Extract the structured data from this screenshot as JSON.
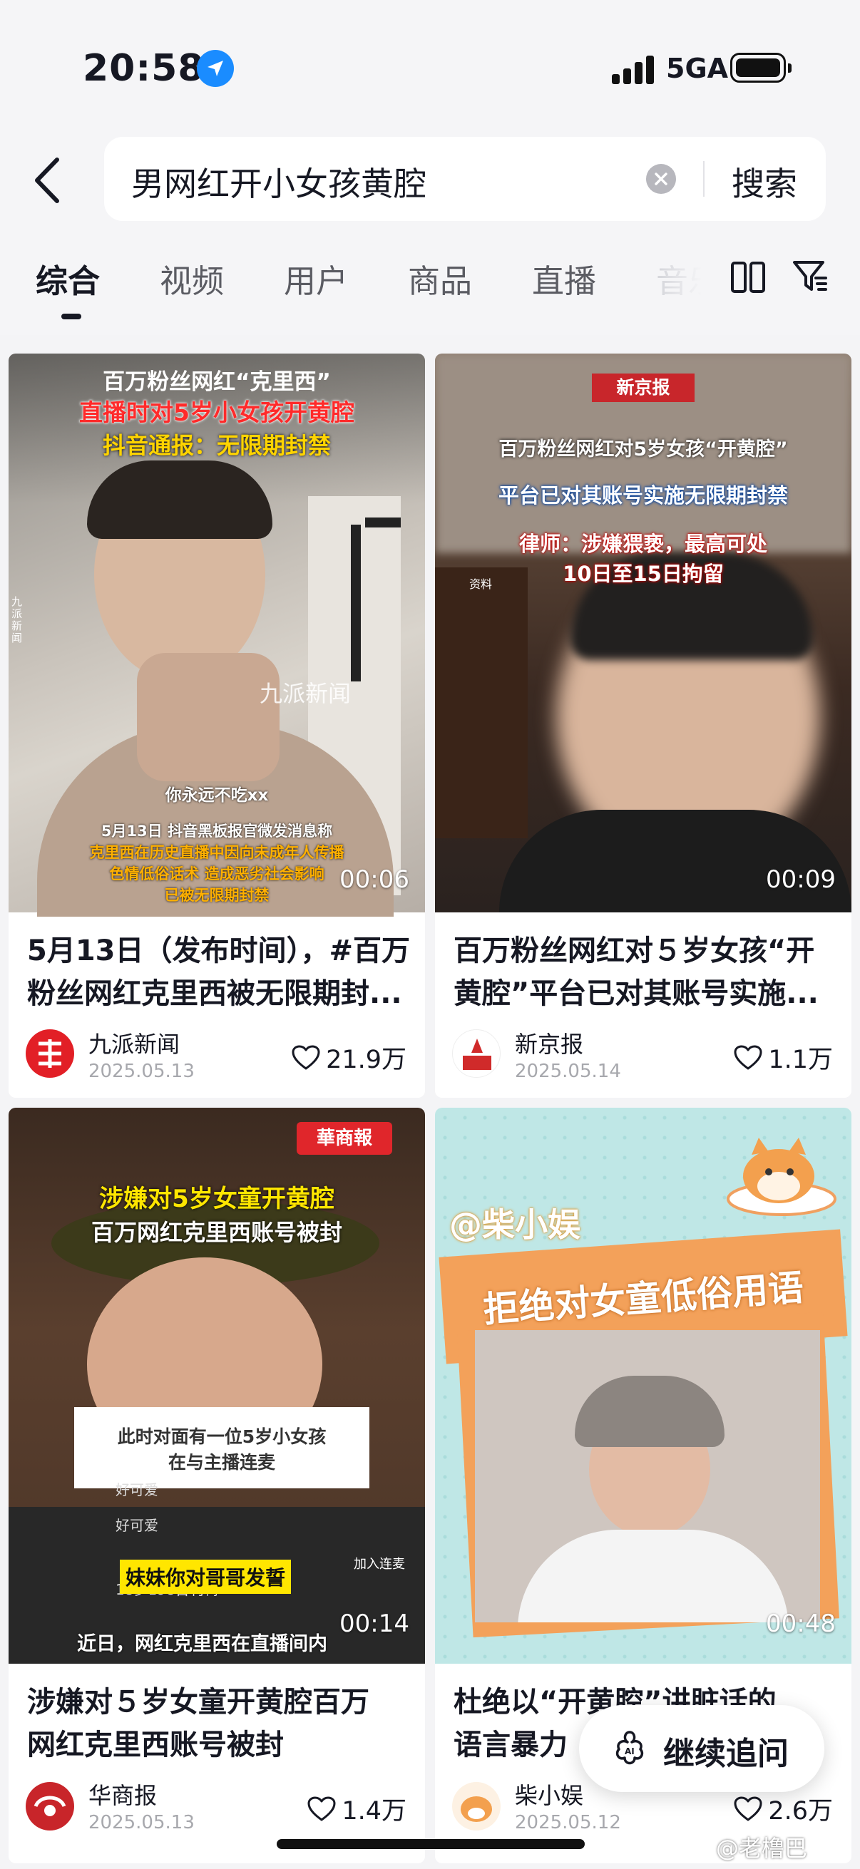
{
  "status_bar": {
    "time": "20:58",
    "network": "5GA"
  },
  "search": {
    "query": "男网红开小女孩黄腔",
    "button_label": "搜索"
  },
  "tabs": [
    {
      "label": "综合",
      "active": true
    },
    {
      "label": "视频"
    },
    {
      "label": "用户"
    },
    {
      "label": "商品"
    },
    {
      "label": "直播"
    },
    {
      "label": "音乐"
    }
  ],
  "results": [
    {
      "title": "5月13日（发布时间），#百万粉丝网红克里西被无限期封...",
      "title_line1": "5月13日（发布时间），#百万",
      "title_line2": "粉丝网红克里西被无限期封...",
      "author": "九派新闻",
      "date": "2025.05.13",
      "likes": "21.9万",
      "duration": "00:06",
      "thumb": {
        "caption1": "百万粉丝网红“克里西”",
        "caption2": "直播时对5岁小女孩开黄腔",
        "caption3": "抖音通报：无限期封禁",
        "watermark": "九派新闻",
        "side": "九派新闻",
        "subtitle": "你永远不吃xx",
        "note1": "5月13日 抖音黑板报官微发消息称",
        "note2": "克里西在历史直播中因向未成年人传播",
        "note3": "色情低俗话术  造成恶劣社会影响",
        "note4": "已被无限期封禁"
      }
    },
    {
      "title": "百万粉丝网红对５岁女孩“开黄腔”平台已对其账号实施...",
      "title_line1": "百万粉丝网红对５岁女孩“开",
      "title_line2": "黄腔”平台已对其账号实施...",
      "author": "新京报",
      "date": "2025.05.14",
      "likes": "1.1万",
      "duration": "00:09",
      "thumb": {
        "badge": "新京报",
        "caption1": "百万粉丝网红对5岁女孩“开黄腔”",
        "caption2": "平台已对其账号实施无限期封禁",
        "caption3": "律师：涉嫌猥亵，最高可处",
        "caption4": "10日至15日拘留",
        "small": "资料"
      }
    },
    {
      "title": "涉嫌对５岁女童开黄腔百万网红克里西账号被封",
      "title_line1": "涉嫌对５岁女童开黄腔百万",
      "title_line2": "网红克里西账号被封",
      "author": "华商报",
      "date": "2025.05.13",
      "likes": "1.4万",
      "duration": "00:14",
      "thumb": {
        "badge": "華商報",
        "caption1": "涉嫌对5岁女童开黄腔",
        "caption2": "百万网红克里西账号被封",
        "box1": "此时对面有一位5岁小女孩",
        "box2": "在与主播连麦",
        "chat1": "妹妹你对哥哥发誓",
        "chat_a": "好可爱",
        "chat_b": "好可爱",
        "chat_c": "加入连麦",
        "chat_d": "18岁198吉利鸭",
        "subtitle": "近日，网红克里西在直播间内"
      }
    },
    {
      "title": "杜绝以“开黄腔”讲脏话的语言暴力",
      "title_line1": "杜绝以“开黄腔”讲脏话的",
      "title_line2": "语言暴力",
      "author": "柴小娱",
      "date": "2025.05.12",
      "likes": "2.6万",
      "duration": "00:48",
      "thumb": {
        "handle": "@柴小娱",
        "banner": "拒绝对女童低俗用语"
      }
    }
  ],
  "follow_up": {
    "label": "继续追问"
  },
  "watermark": "@老橹巴",
  "colors": {
    "accent_red": "#e8282b",
    "blue": "#1a8cff",
    "teal_bg": "#bfe7e6",
    "orange_banner": "#f3a15a"
  }
}
